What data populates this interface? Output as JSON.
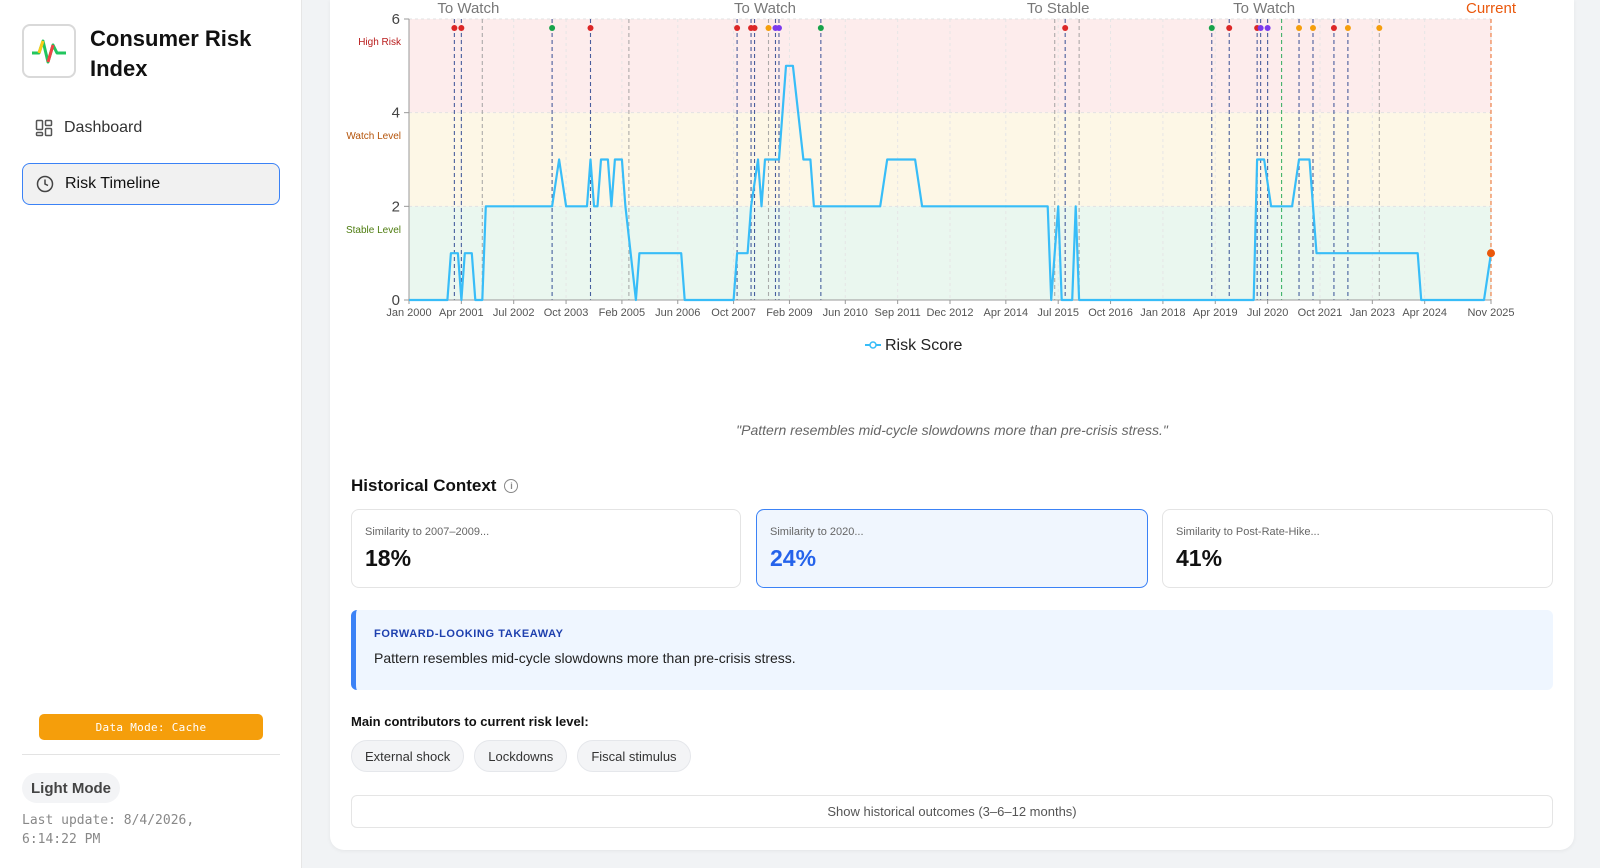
{
  "app": {
    "title": "Consumer Risk Index",
    "nav": [
      {
        "label": "Dashboard",
        "icon": "dashboard-icon",
        "active": false
      },
      {
        "label": "Risk Timeline",
        "icon": "clock-icon",
        "active": true
      }
    ],
    "data_mode": "Data Mode: Cache",
    "theme_toggle": "Light Mode",
    "last_update": "Last update: 8/4/2026, 6:14:22 PM"
  },
  "chart": {
    "zones": [
      {
        "label": "High Risk",
        "color": "#b91c1c",
        "band_color": "#fdecec"
      },
      {
        "label": "Watch Level",
        "color": "#b45309",
        "band_color": "#fdf7e6"
      },
      {
        "label": "Stable Level",
        "color": "#4d7c0f",
        "band_color": "#eaf7ef"
      }
    ],
    "transition_labels": [
      {
        "label": "To Watch",
        "date": "2001-06"
      },
      {
        "label": "To Watch",
        "date": "2008-07"
      },
      {
        "label": "To Stable",
        "date": "2015-07"
      },
      {
        "label": "To Watch",
        "date": "2020-06"
      },
      {
        "label": "Current",
        "date": "2025-11"
      }
    ],
    "legend": "Risk Score",
    "line_color": "#38bdf8",
    "current_color": "#ea580c"
  },
  "chart_data": {
    "type": "line",
    "x_tick_labels": [
      "Jan 2000",
      "Apr 2001",
      "Jul 2002",
      "Oct 2003",
      "Feb 2005",
      "Jun 2006",
      "Oct 2007",
      "Feb 2009",
      "Jun 2010",
      "Sep 2011",
      "Dec 2012",
      "Apr 2014",
      "Jul 2015",
      "Oct 2016",
      "Jan 2018",
      "Apr 2019",
      "Jul 2020",
      "Oct 2021",
      "Jan 2023",
      "Apr 2024",
      "Nov 2025"
    ],
    "y_ticks": [
      0,
      2,
      4,
      6
    ],
    "ylim": [
      0,
      6
    ],
    "xlim": [
      "2000-01",
      "2025-11"
    ],
    "series": [
      {
        "name": "Risk Score",
        "points": [
          [
            "2000-01",
            0
          ],
          [
            "2000-12",
            0
          ],
          [
            "2001-01",
            1
          ],
          [
            "2001-03",
            1
          ],
          [
            "2001-04",
            0
          ],
          [
            "2001-05",
            1
          ],
          [
            "2001-07",
            1
          ],
          [
            "2001-08",
            0
          ],
          [
            "2001-10",
            0
          ],
          [
            "2001-11",
            2
          ],
          [
            "2003-06",
            2
          ],
          [
            "2003-08",
            3
          ],
          [
            "2003-10",
            2
          ],
          [
            "2004-04",
            2
          ],
          [
            "2004-05",
            3
          ],
          [
            "2004-06",
            2
          ],
          [
            "2004-07",
            2
          ],
          [
            "2004-08",
            3
          ],
          [
            "2004-10",
            3
          ],
          [
            "2004-11",
            2
          ],
          [
            "2004-12",
            3
          ],
          [
            "2005-02",
            3
          ],
          [
            "2005-03",
            2
          ],
          [
            "2005-06",
            0
          ],
          [
            "2005-07",
            1
          ],
          [
            "2006-07",
            1
          ],
          [
            "2006-08",
            0
          ],
          [
            "2007-10",
            0
          ],
          [
            "2007-11",
            1
          ],
          [
            "2008-02",
            1
          ],
          [
            "2008-03",
            2
          ],
          [
            "2008-05",
            3
          ],
          [
            "2008-06",
            2
          ],
          [
            "2008-07",
            3
          ],
          [
            "2008-11",
            3
          ],
          [
            "2009-01",
            5
          ],
          [
            "2009-03",
            5
          ],
          [
            "2009-06",
            3
          ],
          [
            "2009-08",
            3
          ],
          [
            "2009-09",
            2
          ],
          [
            "2011-04",
            2
          ],
          [
            "2011-06",
            3
          ],
          [
            "2012-02",
            3
          ],
          [
            "2012-04",
            2
          ],
          [
            "2015-04",
            2
          ],
          [
            "2015-05",
            0
          ],
          [
            "2015-07",
            2
          ],
          [
            "2015-08",
            0
          ],
          [
            "2015-11",
            0
          ],
          [
            "2015-12",
            2
          ],
          [
            "2016-01",
            0
          ],
          [
            "2020-03",
            0
          ],
          [
            "2020-04",
            3
          ],
          [
            "2020-06",
            3
          ],
          [
            "2020-08",
            2
          ],
          [
            "2021-02",
            2
          ],
          [
            "2021-04",
            3
          ],
          [
            "2021-07",
            3
          ],
          [
            "2021-09",
            1
          ],
          [
            "2024-02",
            1
          ],
          [
            "2024-03",
            0
          ],
          [
            "2025-09",
            0
          ],
          [
            "2025-11",
            1
          ]
        ]
      }
    ],
    "grid": true,
    "legend_position": "bottom-center"
  },
  "quote": "\"Pattern resembles mid-cycle slowdowns more than pre-crisis stress.\"",
  "historical": {
    "title": "Historical Context",
    "cards": [
      {
        "label": "Similarity to 2007–2009...",
        "value": "18%",
        "selected": false
      },
      {
        "label": "Similarity to 2020...",
        "value": "24%",
        "selected": true
      },
      {
        "label": "Similarity to Post-Rate-Hike...",
        "value": "41%",
        "selected": false
      }
    ]
  },
  "takeaway": {
    "heading": "FORWARD-LOOKING TAKEAWAY",
    "text": "Pattern resembles mid-cycle slowdowns more than pre-crisis stress."
  },
  "contributors": {
    "label": "Main contributors to current risk level:",
    "chips": [
      "External shock",
      "Lockdowns",
      "Fiscal stimulus"
    ]
  },
  "outcomes_button": "Show historical outcomes (3–6–12 months)"
}
